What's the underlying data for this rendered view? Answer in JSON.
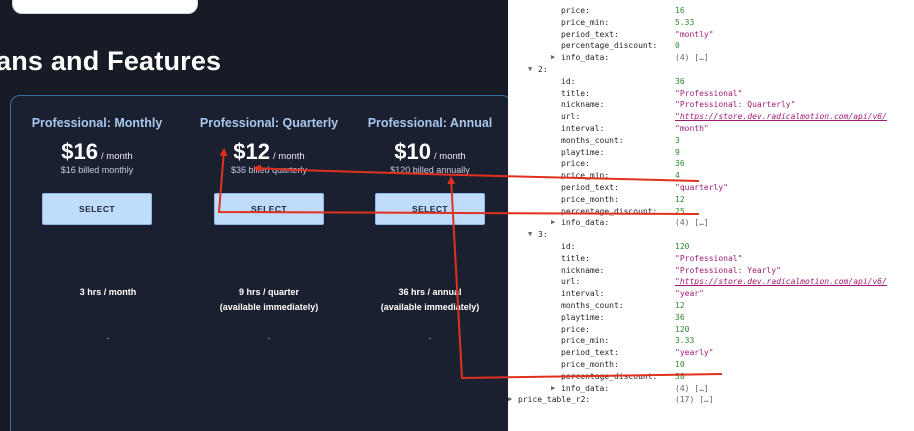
{
  "page": {
    "heading": "ans and Features"
  },
  "plans": [
    {
      "title": "Professional: Monthly",
      "price": "$16",
      "unit": "/ month",
      "billed": "$16 billed monthly",
      "select": "SELECT",
      "hours_line1": "3 hrs / month",
      "hours_line2": "",
      "dash": "-"
    },
    {
      "title": "Professional: Quarterly",
      "price": "$12",
      "unit": "/ month",
      "billed": "$36 billed quarterly",
      "select": "SELECT",
      "hours_line1": "9 hrs / quarter",
      "hours_line2": "(available immediately)",
      "dash": "-"
    },
    {
      "title": "Professional: Annual",
      "price": "$10",
      "unit": "/ month",
      "billed": "$120 billed annually",
      "select": "SELECT",
      "hours_line1": "36 hrs / annual",
      "hours_line2": "(available immediately)",
      "dash": "-"
    }
  ],
  "inspector": {
    "rows": [
      {
        "key": "price:",
        "val": "16",
        "type": "num"
      },
      {
        "key": "price_min:",
        "val": "5.33",
        "type": "num"
      },
      {
        "key": "period_text:",
        "val": "\"montly\"",
        "type": "str"
      },
      {
        "key": "percentage_discount:",
        "val": "0",
        "type": "num"
      },
      {
        "key": "info_data:",
        "val": "(4) […]",
        "type": "gray",
        "expander": "▶"
      },
      {
        "key": "2:",
        "val": "",
        "type": "gray",
        "expander": "▼"
      },
      {
        "key": "id:",
        "val": "36",
        "type": "num"
      },
      {
        "key": "title:",
        "val": "\"Professional\"",
        "type": "str"
      },
      {
        "key": "nickname:",
        "val": "\"Professional: Quarterly\"",
        "type": "str"
      },
      {
        "key": "url:",
        "val": "\"https://store.dev.radicalmotion.com/api/v6/",
        "type": "url"
      },
      {
        "key": "interval:",
        "val": "\"month\"",
        "type": "str"
      },
      {
        "key": "months_count:",
        "val": "3",
        "type": "num"
      },
      {
        "key": "playtime:",
        "val": "9",
        "type": "num"
      },
      {
        "key": "price:",
        "val": "36",
        "type": "num"
      },
      {
        "key": "price_min:",
        "val": "4",
        "type": "num"
      },
      {
        "key": "period_text:",
        "val": "\"quarterly\"",
        "type": "str"
      },
      {
        "key": "price_month:",
        "val": "12",
        "type": "num"
      },
      {
        "key": "percentage_discount:",
        "val": "25",
        "type": "num"
      },
      {
        "key": "info_data:",
        "val": "(4) […]",
        "type": "gray",
        "expander": "▶"
      },
      {
        "key": "3:",
        "val": "",
        "type": "gray",
        "expander": "▼"
      },
      {
        "key": "id:",
        "val": "120",
        "type": "num"
      },
      {
        "key": "title:",
        "val": "\"Professional\"",
        "type": "str"
      },
      {
        "key": "nickname:",
        "val": "\"Professional: Yearly\"",
        "type": "str"
      },
      {
        "key": "url:",
        "val": "\"https://store.dev.radicalmotion.com/api/v6/",
        "type": "url"
      },
      {
        "key": "interval:",
        "val": "\"year\"",
        "type": "str"
      },
      {
        "key": "months_count:",
        "val": "12",
        "type": "num"
      },
      {
        "key": "playtime:",
        "val": "36",
        "type": "num"
      },
      {
        "key": "price:",
        "val": "120",
        "type": "num"
      },
      {
        "key": "price_min:",
        "val": "3.33",
        "type": "num"
      },
      {
        "key": "period_text:",
        "val": "\"yearly\"",
        "type": "str"
      },
      {
        "key": "price_month:",
        "val": "10",
        "type": "num"
      },
      {
        "key": "percentage_discount:",
        "val": "38",
        "type": "num"
      },
      {
        "key": "info_data:",
        "val": "(4) […]",
        "type": "gray",
        "expander": "▶"
      },
      {
        "key": "price_table_r2:",
        "val": "(17) […]",
        "type": "gray",
        "expander": "▶"
      }
    ]
  },
  "colors": {
    "annotation": "#e0301e",
    "background": "#161b26",
    "accent": "#bfdcfb"
  }
}
